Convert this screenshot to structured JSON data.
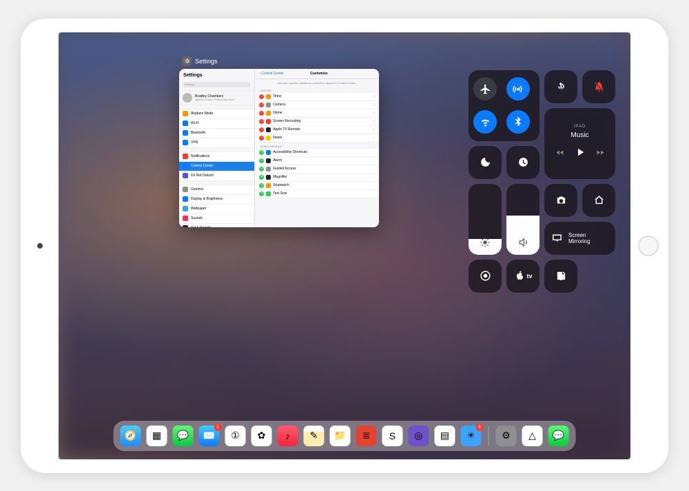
{
  "app_switcher": {
    "title": "Settings",
    "left": {
      "header": "Settings",
      "search_placeholder": "Settings",
      "profile": {
        "name": "Bradley Chambers",
        "sub": "Apple ID, iCloud, iTunes & App Store"
      },
      "group1": [
        {
          "label": "Airplane Mode",
          "color": "#ff9500"
        },
        {
          "label": "Wi-Fi",
          "color": "#0a7aff"
        },
        {
          "label": "Bluetooth",
          "color": "#0a7aff"
        },
        {
          "label": "VPN",
          "color": "#0a7aff"
        }
      ],
      "group2": [
        {
          "label": "Notifications",
          "color": "#ff3b30"
        },
        {
          "label": "Control Center",
          "color": "#0a7aff",
          "selected": true
        },
        {
          "label": "Do Not Disturb",
          "color": "#5856d6"
        }
      ],
      "group3": [
        {
          "label": "General",
          "color": "#8e8e93"
        },
        {
          "label": "Display & Brightness",
          "color": "#0a7aff"
        },
        {
          "label": "Wallpaper",
          "color": "#34aadc"
        },
        {
          "label": "Sounds",
          "color": "#ff2d55"
        },
        {
          "label": "Siri & Search",
          "color": "#222"
        }
      ]
    },
    "right": {
      "back": "Control Center",
      "title": "Customize",
      "sub": "Add and organize additional controls to appear in Control Center.",
      "include_label": "Include",
      "include": [
        {
          "label": "Timer",
          "color": "#ff9500"
        },
        {
          "label": "Camera",
          "color": "#8e8e93"
        },
        {
          "label": "Home",
          "color": "#ff9500"
        },
        {
          "label": "Screen Recording",
          "color": "#ff3b30"
        },
        {
          "label": "Apple TV Remote",
          "color": "#222"
        },
        {
          "label": "Notes",
          "color": "#ffcc00"
        }
      ],
      "more_label": "More Controls",
      "more": [
        {
          "label": "Accessibility Shortcuts",
          "color": "#0a7aff"
        },
        {
          "label": "Alarm",
          "color": "#222"
        },
        {
          "label": "Guided Access",
          "color": "#8e8e93"
        },
        {
          "label": "Magnifier",
          "color": "#222"
        },
        {
          "label": "Stopwatch",
          "color": "#ff9500"
        },
        {
          "label": "Text Size",
          "color": "#34c759"
        }
      ]
    }
  },
  "cc": {
    "media": {
      "device": "IPAD",
      "title": "Music"
    },
    "brightness_pct": 22,
    "volume_pct": 55,
    "screen_mirroring": "Screen\nMirroring",
    "appletv": "tv"
  },
  "dock": {
    "apps_left": [
      {
        "name": "safari",
        "bg": "linear-gradient(#4ecbff,#1d8cff)"
      },
      {
        "name": "calendar",
        "bg": "#fff"
      },
      {
        "name": "messages",
        "bg": "linear-gradient(#5ff777,#09c93f)"
      },
      {
        "name": "mail",
        "bg": "linear-gradient(#3fccff,#1376f8)",
        "badge": "1"
      },
      {
        "name": "1password",
        "bg": "#fff"
      },
      {
        "name": "photos",
        "bg": "#fff"
      },
      {
        "name": "music",
        "bg": "linear-gradient(#fb5b73,#fa233b)"
      },
      {
        "name": "notes",
        "bg": "linear-gradient(#fff 30%,#ffeeaf 30%)"
      },
      {
        "name": "files",
        "bg": "#fff"
      },
      {
        "name": "todoist",
        "bg": "#e44332"
      },
      {
        "name": "slack",
        "bg": "#fff"
      },
      {
        "name": "omnifocus",
        "bg": "#6f52c9"
      },
      {
        "name": "feedly",
        "bg": "#fff"
      },
      {
        "name": "carrot",
        "bg": "#3aa4ff",
        "badge": "4"
      }
    ],
    "apps_right": [
      {
        "name": "settings",
        "bg": "#8e8e93"
      },
      {
        "name": "drive",
        "bg": "#fff"
      },
      {
        "name": "messages-2",
        "bg": "linear-gradient(#5ff777,#09c93f)"
      }
    ]
  }
}
